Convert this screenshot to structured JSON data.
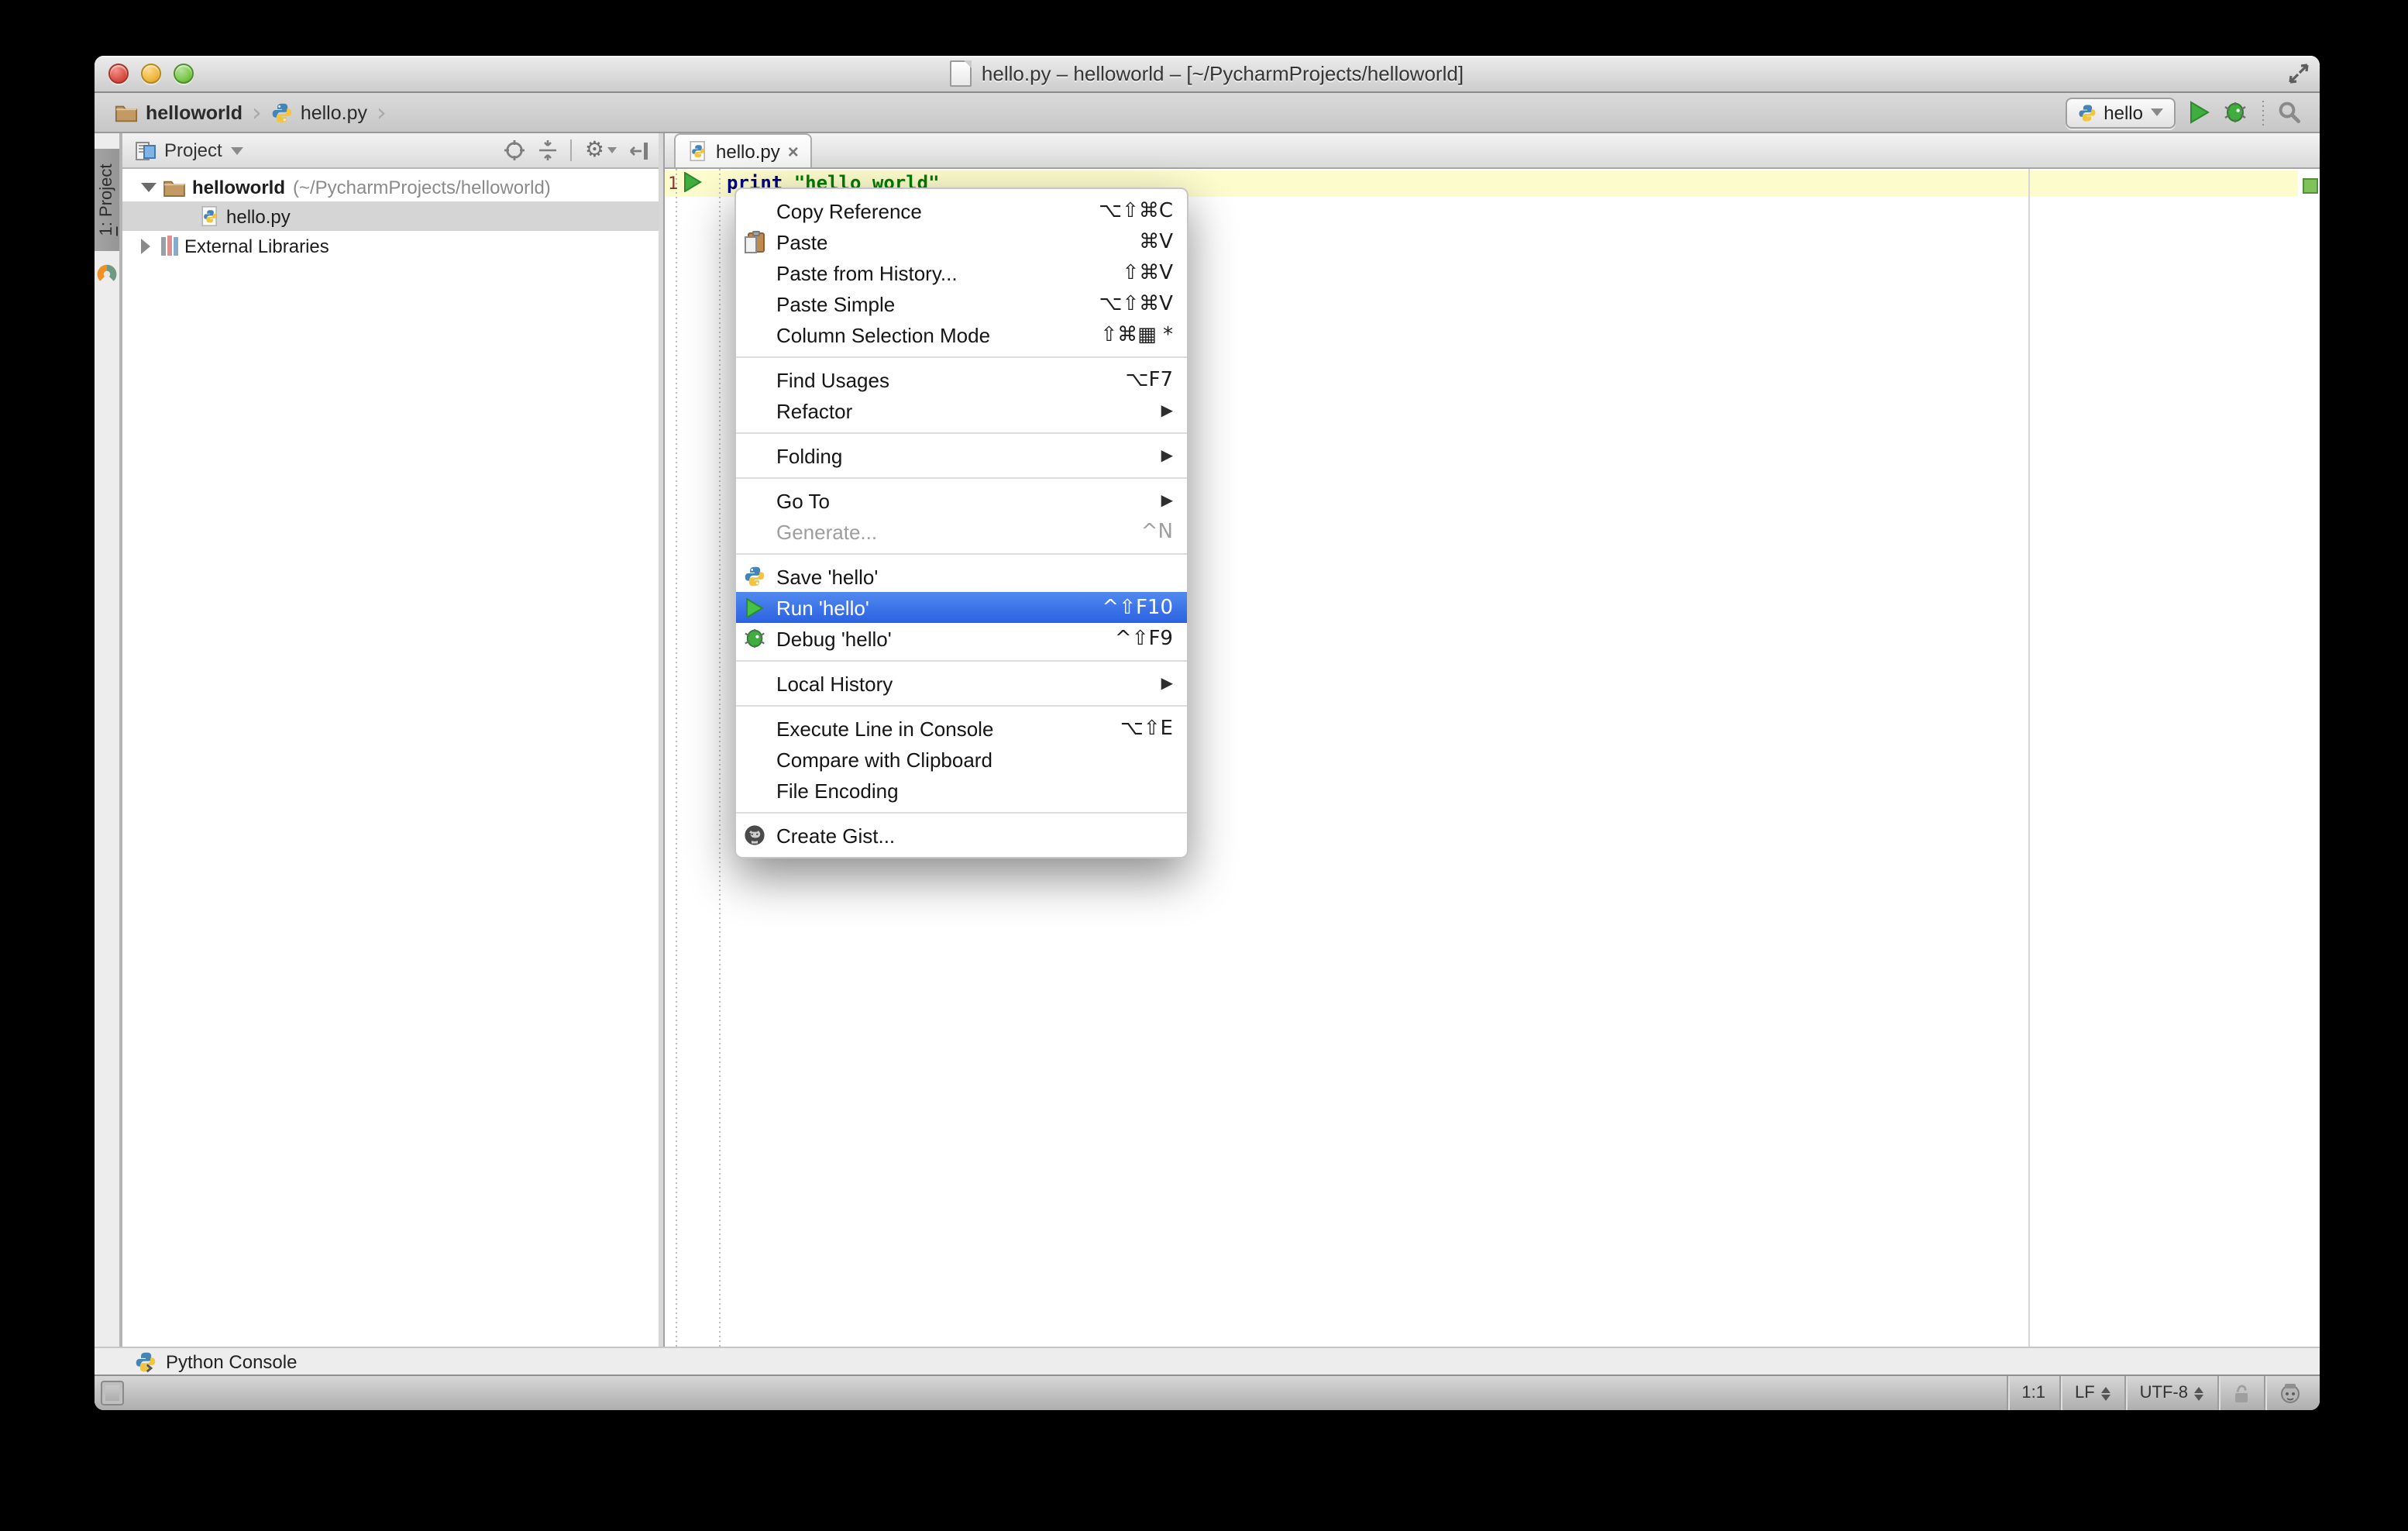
{
  "window": {
    "title": "hello.py – helloworld – [~/PycharmProjects/helloworld]"
  },
  "breadcrumbs": {
    "project": "helloworld",
    "file": "hello.py"
  },
  "run": {
    "config": "hello"
  },
  "panel": {
    "title": "Project"
  },
  "stripe": {
    "number": "1",
    "label": ": Project"
  },
  "tree": {
    "items": [
      {
        "name": "helloworld",
        "path": "(~/PycharmProjects/helloworld)"
      },
      {
        "name": "hello.py"
      },
      {
        "name": "External Libraries"
      }
    ]
  },
  "tab": {
    "label": "hello.py"
  },
  "code": {
    "line_number": "1",
    "keyword": "print",
    "string": "\"hello world\""
  },
  "menu": {
    "items": [
      {
        "label": "Copy Reference",
        "shortcut": "⌥⇧⌘C"
      },
      {
        "label": "Paste",
        "shortcut": "⌘V",
        "icon": "paste"
      },
      {
        "label": "Paste from History...",
        "shortcut": "⇧⌘V"
      },
      {
        "label": "Paste Simple",
        "shortcut": "⌥⇧⌘V"
      },
      {
        "label": "Column Selection Mode",
        "shortcut": "⇧⌘▦ *"
      },
      {
        "label": "Find Usages",
        "shortcut": "⌥F7"
      },
      {
        "label": "Refactor",
        "submenu": true
      },
      {
        "label": "Folding",
        "submenu": true
      },
      {
        "label": "Go To",
        "submenu": true
      },
      {
        "label": "Generate...",
        "shortcut": "^N",
        "disabled": true
      },
      {
        "label": "Save 'hello'",
        "icon": "python"
      },
      {
        "label": "Run 'hello'",
        "shortcut": "^⇧F10",
        "icon": "run",
        "selected": true
      },
      {
        "label": "Debug 'hello'",
        "shortcut": "^⇧F9",
        "icon": "debug"
      },
      {
        "label": "Local History",
        "submenu": true
      },
      {
        "label": "Execute Line in Console",
        "shortcut": "⌥⇧E"
      },
      {
        "label": "Compare with Clipboard"
      },
      {
        "label": "File Encoding"
      },
      {
        "label": "Create Gist...",
        "icon": "github"
      }
    ]
  },
  "console": {
    "label": "Python Console"
  },
  "status": {
    "position": "1:1",
    "eol": "LF",
    "encoding": "UTF-8"
  },
  "glyphs": {
    "chevron": "›",
    "close": "×",
    "gear": "⚙",
    "submenu_arrow": "▶"
  },
  "colors": {
    "menu_selection_blue": "#3b74e8",
    "line_highlight": "#fcfccd",
    "keyword_blue": "#000080",
    "string_green": "#007d00",
    "tree_selection_gray": "#d5d5d5",
    "ok_indicator_green": "#7dc35a"
  }
}
